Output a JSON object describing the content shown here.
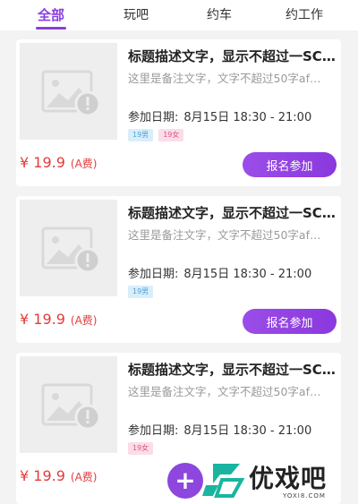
{
  "tabs": [
    {
      "label": "全部",
      "active": true
    },
    {
      "label": "玩吧",
      "active": false
    },
    {
      "label": "约车",
      "active": false
    },
    {
      "label": "约工作",
      "active": false
    }
  ],
  "colors": {
    "accent": "#8a3ee0",
    "price": "#e33b3b"
  },
  "cards": [
    {
      "title": "标题描述文字，显示不超过一SC...",
      "note": "这里是备注文字，文字不超过50字afaf...",
      "date_label": "参加日期:",
      "date_value": "8月15日 18:30 - 21:00",
      "tags": [
        {
          "label": "19男",
          "kind": "male"
        },
        {
          "label": "19女",
          "kind": "female"
        }
      ],
      "price": "¥ 19.9",
      "fee": "(A费)",
      "button_label": "报名参加",
      "image_icon": "image-placeholder-icon"
    },
    {
      "title": "标题描述文字，显示不超过一SC...",
      "note": "这里是备注文字，文字不超过50字afaf...",
      "date_label": "参加日期:",
      "date_value": "8月15日 18:30 - 21:00",
      "tags": [
        {
          "label": "19男",
          "kind": "male"
        }
      ],
      "price": "¥ 19.9",
      "fee": "(A费)",
      "button_label": "报名参加",
      "image_icon": "image-placeholder-icon"
    },
    {
      "title": "标题描述文字，显示不超过一SC...",
      "note": "这里是备注文字，文字不超过50字afaf...",
      "date_label": "参加日期:",
      "date_value": "8月15日 18:30 - 21:00",
      "tags": [
        {
          "label": "19女",
          "kind": "female"
        }
      ],
      "price": "¥ 19.9",
      "fee": "(A费)",
      "button_label": "报名参加",
      "image_icon": "image-placeholder-icon"
    }
  ],
  "watermark": {
    "text": "优戏吧",
    "url": "YOXI8.COM",
    "icon": "plus-icon"
  }
}
